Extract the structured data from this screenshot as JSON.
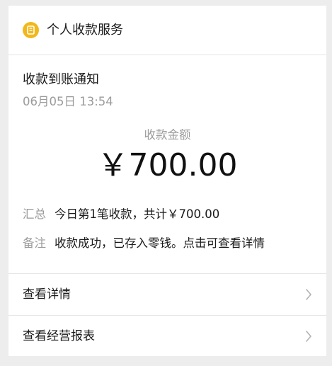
{
  "header": {
    "service_icon": "wallet-icon",
    "service_name": "个人收款服务",
    "accent_color": "#f2b81b"
  },
  "notice": {
    "title": "收款到账通知",
    "time": "06月05日 13:54"
  },
  "amount": {
    "label": "收款金额",
    "value": "￥700.00"
  },
  "details": [
    {
      "key": "汇总",
      "value": "今日第1笔收款，共计￥700.00"
    },
    {
      "key": "备注",
      "value": "收款成功，已存入零钱。点击可查看详情"
    }
  ],
  "actions": [
    {
      "label": "查看详情",
      "icon": "chevron-right-icon"
    },
    {
      "label": "查看经营报表",
      "icon": "chevron-right-icon"
    }
  ]
}
